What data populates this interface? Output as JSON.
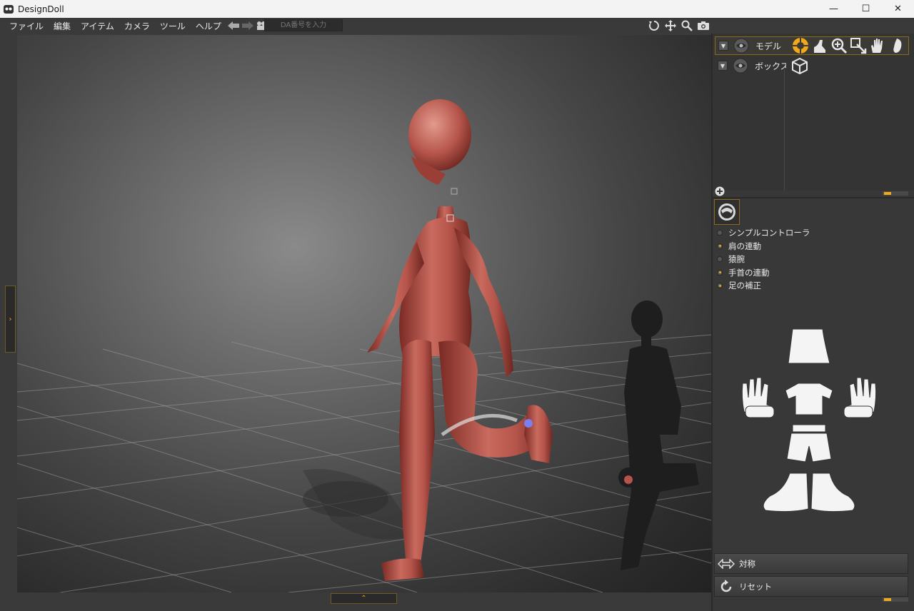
{
  "window": {
    "title": "DesignDoll",
    "minimize": "—",
    "maximize": "☐",
    "close": "✕"
  },
  "menu": {
    "items": [
      "ファイル",
      "編集",
      "アイテム",
      "カメラ",
      "ツール",
      "ヘルプ"
    ]
  },
  "toolbar": {
    "da_placeholder": "DA番号を入力"
  },
  "scene": {
    "rows": [
      {
        "label": "モデル"
      },
      {
        "label": "ボックス"
      }
    ]
  },
  "controller": {
    "options": [
      {
        "label": "シンプルコントローラ",
        "on": false
      },
      {
        "label": "肩の連動",
        "on": true
      },
      {
        "label": "猿腕",
        "on": false
      },
      {
        "label": "手首の連動",
        "on": true
      },
      {
        "label": "足の補正",
        "on": true
      }
    ]
  },
  "buttons": {
    "symmetry": "対称",
    "reset": "リセット"
  },
  "colors": {
    "accent": "#f0a81d",
    "doll": "#b5544a"
  }
}
